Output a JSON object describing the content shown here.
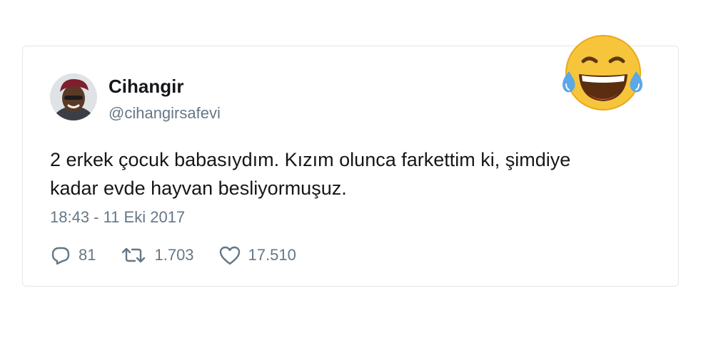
{
  "tweet": {
    "author": {
      "display_name": "Cihangir",
      "handle": "@cihangirsafevi"
    },
    "text_lines": [
      "2 erkek çocuk babasıydım. Kızım olunca farkettim ki, şimdiye",
      "kadar evde hayvan besliyormuşuz."
    ],
    "timestamp": "18:43 - 11 Eki 2017",
    "actions": {
      "replies": "81",
      "retweets": "1.703",
      "likes": "17.510"
    }
  },
  "icons": {
    "reply": "reply-icon",
    "retweet": "retweet-icon",
    "like": "heart-icon",
    "emoji": "face-with-tears-of-joy-emoji"
  },
  "colors": {
    "text_primary": "#14171a",
    "text_secondary": "#657786",
    "card_border": "#e3e6e9",
    "emoji_yellow": "#f7c53c",
    "tear_blue": "#5aa8e6"
  }
}
